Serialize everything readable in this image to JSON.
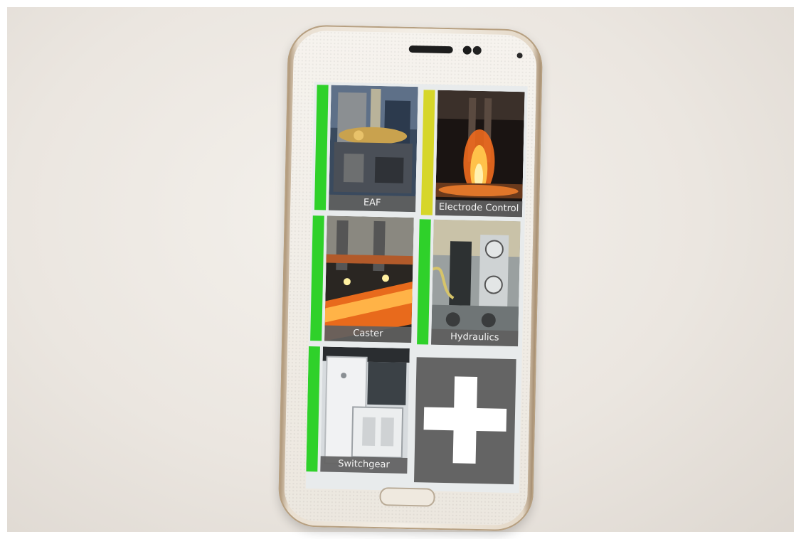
{
  "colors": {
    "status_green": "#2fd12a",
    "status_yellow": "#d6d62a",
    "tile_caption_bg": "#5f5f5f",
    "add_tile_bg": "#646464"
  },
  "tiles": [
    {
      "label": "EAF",
      "status": "green",
      "icon": "eaf-photo"
    },
    {
      "label": "Electrode Control",
      "status": "yellow",
      "icon": "electrode-furnace-photo"
    },
    {
      "label": "Caster",
      "status": "green",
      "icon": "caster-photo"
    },
    {
      "label": "Hydraulics",
      "status": "green",
      "icon": "hydraulics-photo"
    },
    {
      "label": "Switchgear",
      "status": "green",
      "icon": "switchgear-photo"
    }
  ],
  "add_tile": {
    "icon": "plus-icon"
  }
}
